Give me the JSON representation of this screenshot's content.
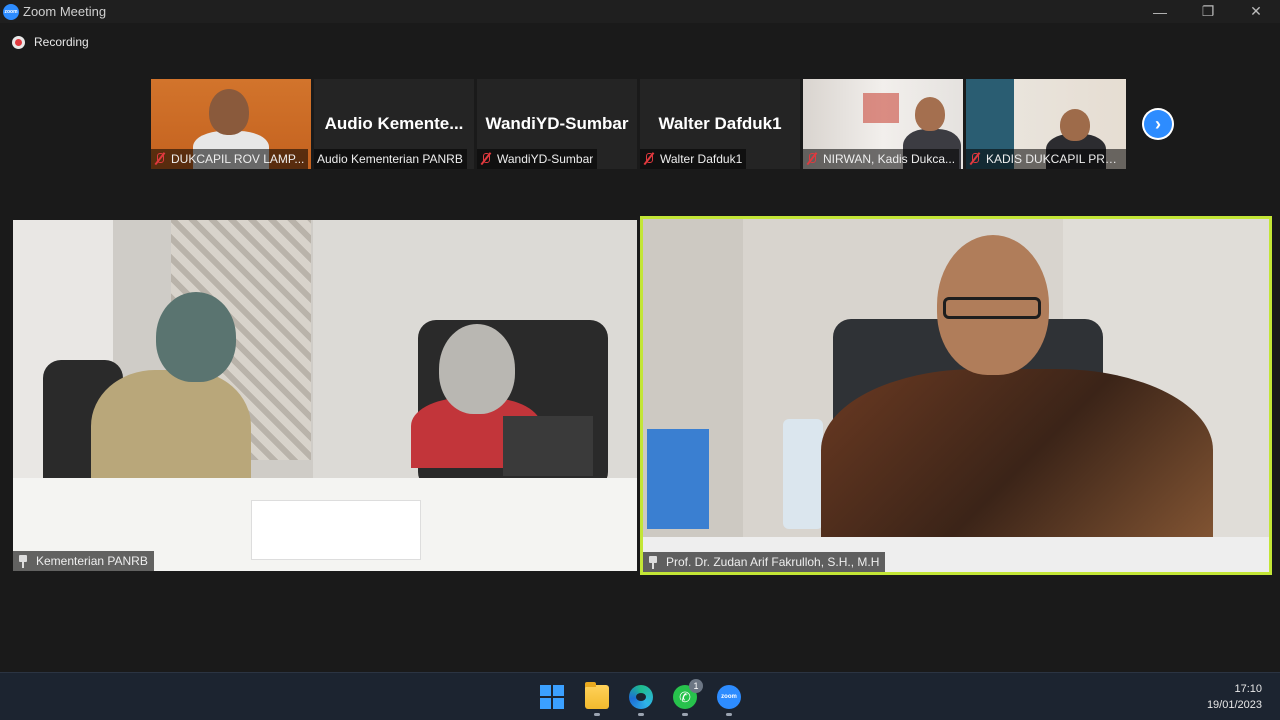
{
  "window": {
    "title": "Zoom Meeting",
    "minimize_glyph": "—",
    "maximize_glyph": "❐",
    "close_glyph": "✕"
  },
  "recording": {
    "label": "Recording"
  },
  "thumbnails": [
    {
      "name": "DUKCAPIL ROV LAMP...",
      "big_label": "",
      "muted": true,
      "video": true
    },
    {
      "name": "Audio Kementerian PANRB",
      "big_label": "Audio  Kemente...",
      "muted": false,
      "video": false
    },
    {
      "name": "WandiYD-Sumbar",
      "big_label": "WandiYD-Sumbar",
      "muted": true,
      "video": false
    },
    {
      "name": "Walter Dafduk1",
      "big_label": "Walter Dafduk1",
      "muted": true,
      "video": false
    },
    {
      "name": "NIRWAN, Kadis Dukca...",
      "big_label": "",
      "muted": true,
      "video": true
    },
    {
      "name": "KADIS DUKCAPIL PRO...",
      "big_label": "",
      "muted": true,
      "video": true
    }
  ],
  "next_page": {
    "glyph": "›"
  },
  "main_tiles": {
    "left": {
      "name": "Kementerian PANRB"
    },
    "right": {
      "name": "Prof. Dr. Zudan Arif Fakrulloh, S.H., M.H",
      "active_speaker": true
    }
  },
  "taskbar": {
    "apps": [
      {
        "name": "Start",
        "icon": "windows-icon"
      },
      {
        "name": "File Explorer",
        "icon": "folder-icon"
      },
      {
        "name": "Microsoft Edge",
        "icon": "edge-icon"
      },
      {
        "name": "WhatsApp",
        "icon": "whatsapp-icon",
        "badge": "1"
      },
      {
        "name": "Zoom",
        "icon": "zoom-icon",
        "label": "zoom"
      }
    ],
    "clock": {
      "time": "17:10",
      "date": "19/01/2023"
    }
  },
  "colors": {
    "accent_blue": "#2d8cff",
    "active_speaker_border": "#c3e636",
    "muted_red": "#e0393e",
    "background": "#1a1a1a"
  }
}
